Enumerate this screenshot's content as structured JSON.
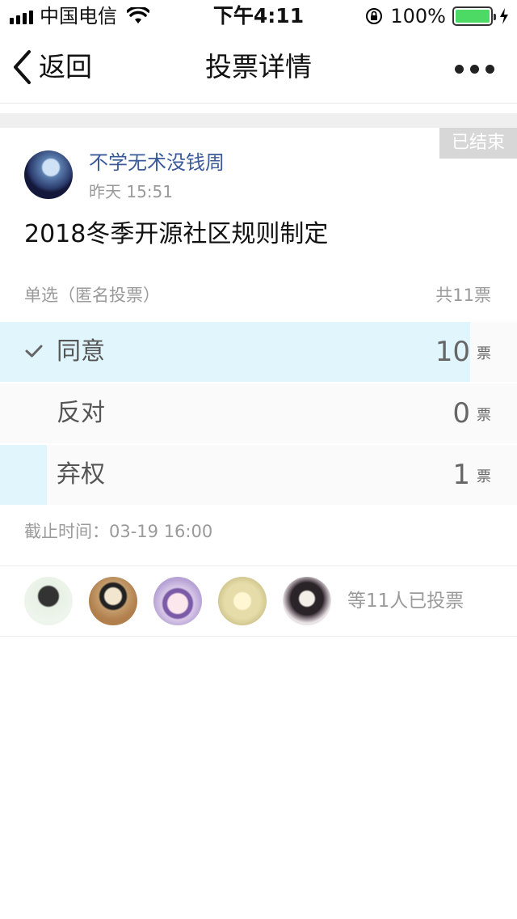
{
  "status_bar": {
    "carrier": "中国电信",
    "time": "下午4:11",
    "battery_percent": "100%",
    "battery_level": 1.0,
    "battery_color": "#4cd964"
  },
  "nav": {
    "back_label": "返回",
    "title": "投票详情",
    "back_icon": "chevron-left-icon",
    "more_icon": "more-dots-icon"
  },
  "poll": {
    "status_badge": "已结束",
    "author": "不学无术没钱周",
    "post_time": "昨天 15:51",
    "title": "2018冬季开源社区规则制定",
    "type": "单选（匿名投票）",
    "total": "共11票",
    "unit": "票",
    "options": [
      {
        "label": "同意",
        "count": "10",
        "fraction": 0.909,
        "selected": true
      },
      {
        "label": "反对",
        "count": "0",
        "fraction": 0.0,
        "selected": false
      },
      {
        "label": "弃权",
        "count": "1",
        "fraction": 0.091,
        "selected": false
      }
    ],
    "deadline": "截止时间：03-19 16:00",
    "voters_summary": "等11人已投票",
    "voter_count_shown": 5
  },
  "colors": {
    "accent_fill": "#e1f5fd",
    "author_blue": "#3a5a99",
    "muted_text": "#9a9a9a"
  }
}
